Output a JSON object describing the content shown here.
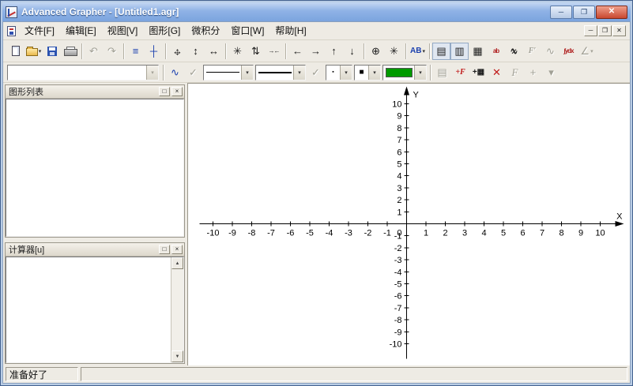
{
  "window": {
    "title": "Advanced Grapher - [Untitled1.agr]",
    "controls": {
      "minimize": "─",
      "maximize": "❐",
      "close": "✕"
    }
  },
  "menubar": {
    "items": [
      "文件[F]",
      "编辑[E]",
      "视图[V]",
      "图形[G]",
      "微积分",
      "窗口[W]",
      "帮助[H]"
    ],
    "mdi": {
      "minimize": "─",
      "restore": "❐",
      "close": "✕"
    }
  },
  "chars": {
    "dropdown": "▾",
    "scroll_up": "▲",
    "scroll_down": "▼"
  },
  "toolbar_main": {
    "buttons": [
      {
        "name": "new-file",
        "shape": "new"
      },
      {
        "name": "open-file",
        "shape": "open",
        "dropdown": true
      },
      {
        "name": "save-file",
        "shape": "save"
      },
      {
        "name": "print",
        "shape": "print"
      },
      {
        "sep": true
      },
      {
        "name": "undo",
        "glyph": "↶",
        "disabled": true
      },
      {
        "name": "redo",
        "glyph": "↷",
        "disabled": true
      },
      {
        "sep": true
      },
      {
        "name": "graph-list",
        "glyph": "≡",
        "color": "#1a3fae"
      },
      {
        "name": "axes-setup",
        "glyph": "┼",
        "color": "#1a3fae"
      },
      {
        "sep": true
      },
      {
        "name": "move-plot",
        "glyph": "↔",
        "glyph2": "↕"
      },
      {
        "name": "stretch-vertical",
        "glyph": "↕"
      },
      {
        "name": "stretch-horizontal",
        "glyph": "↔"
      },
      {
        "sep": true
      },
      {
        "name": "zoom-all",
        "glyph": "✳"
      },
      {
        "name": "compress-vertical",
        "glyph": "⇅"
      },
      {
        "name": "compress-horizontal",
        "glyph": "→←",
        "small": true
      },
      {
        "sep": true
      },
      {
        "name": "scroll-left",
        "glyph": "←"
      },
      {
        "name": "scroll-right",
        "glyph": "→"
      },
      {
        "name": "scroll-up",
        "glyph": "↑"
      },
      {
        "name": "scroll-down",
        "glyph": "↓"
      },
      {
        "sep": true
      },
      {
        "name": "center-origin",
        "glyph": "⊕"
      },
      {
        "name": "restore-view",
        "glyph": "✳"
      },
      {
        "sep": true
      },
      {
        "name": "text-labels",
        "glyph": "AB",
        "color": "#1a3fae",
        "dropdown": true
      },
      {
        "sep": true
      },
      {
        "name": "toggle-graph-list",
        "glyph": "▤",
        "pressed": true
      },
      {
        "name": "toggle-calculator",
        "glyph": "▥",
        "pressed": true
      },
      {
        "name": "table-of-values",
        "glyph": "▦"
      },
      {
        "name": "evaluate",
        "glyph": "ab",
        "small": true,
        "color": "#b02020"
      },
      {
        "name": "intersections",
        "glyph": "∿",
        "glyph2": "×"
      },
      {
        "name": "derivative",
        "glyph": "F′",
        "disabled": true,
        "italic": true
      },
      {
        "name": "tangent-line",
        "glyph": "∿",
        "disabled": true
      },
      {
        "name": "integral",
        "glyph": "∫ydx",
        "small": true,
        "color": "#b02020"
      },
      {
        "name": "analysis-menu",
        "glyph": "∠",
        "disabled": true,
        "dropdown": true
      }
    ]
  },
  "toolbar_format": {
    "formula_combo": {
      "value": ""
    },
    "marker_small": "▪",
    "marker_large": "■",
    "color_swatch": "#009a00",
    "buttons": [
      {
        "sep": true
      },
      {
        "name": "curve-kind",
        "glyph": "∿",
        "color": "#1a3fae"
      },
      {
        "name": "check-draw",
        "glyph": "✓",
        "disabled": true
      },
      {
        "combo": "line-style"
      },
      {
        "combo": "line-width"
      },
      {
        "name": "check-fill",
        "glyph": "✓",
        "disabled": true
      },
      {
        "combo": "marker-size"
      },
      {
        "combo": "marker-style"
      },
      {
        "combo": "color"
      },
      {
        "sep": true
      },
      {
        "name": "graph-properties",
        "glyph": "▤",
        "disabled": true
      },
      {
        "name": "add-graph",
        "glyph": "+F",
        "color": "#c01818",
        "italic": true
      },
      {
        "name": "add-table-graph",
        "glyph": "+▦"
      },
      {
        "name": "delete-graph",
        "glyph": "✕",
        "color": "#c01818"
      },
      {
        "name": "edit-graph",
        "glyph": "F",
        "disabled": true,
        "italic": true
      },
      {
        "name": "duplicate-graph",
        "glyph": "+",
        "disabled": true
      },
      {
        "name": "more-options",
        "glyph": "▾",
        "disabled": true
      }
    ]
  },
  "panels": {
    "graph_list": {
      "title": "图形列表",
      "restore": "□",
      "close": "×"
    },
    "calculator": {
      "title": "计算器[u]",
      "restore": "□",
      "close": "×"
    }
  },
  "graph": {
    "x_axis_label": "X",
    "y_axis_label": "Y",
    "origin_label": "0",
    "x_min": -10,
    "x_max": 10,
    "y_min": -10,
    "y_max": 10,
    "x_ticks": [
      -10,
      -9,
      -8,
      -7,
      -6,
      -5,
      -4,
      -3,
      -2,
      -1,
      1,
      2,
      3,
      4,
      5,
      6,
      7,
      8,
      9,
      10
    ],
    "y_ticks": [
      -10,
      -9,
      -8,
      -7,
      -6,
      -5,
      -4,
      -3,
      -2,
      -1,
      1,
      2,
      3,
      4,
      5,
      6,
      7,
      8,
      9,
      10
    ]
  },
  "statusbar": {
    "message": "准备好了"
  }
}
